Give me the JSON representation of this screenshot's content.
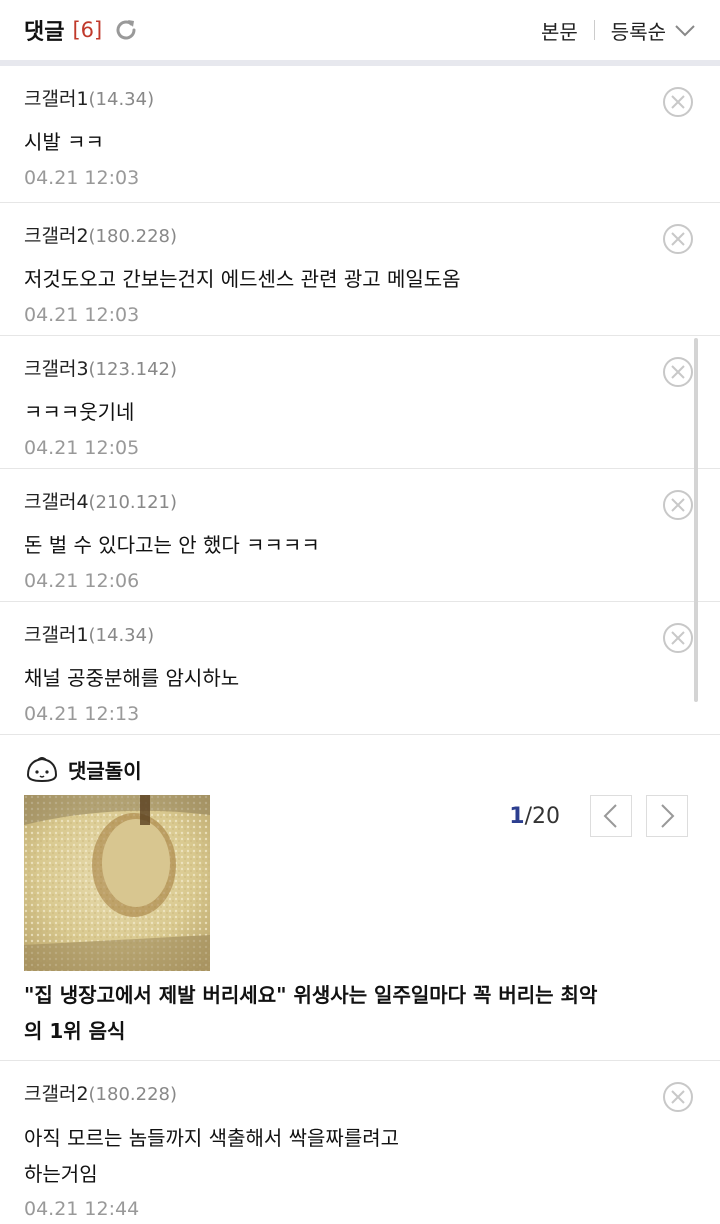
{
  "header": {
    "title": "댓글",
    "count": "[6]",
    "body_label": "본문",
    "sort_label": "등록순"
  },
  "comments": [
    {
      "author": "크갤러1",
      "ip": "(14.34)",
      "body": "시발 ㅋㅋ",
      "time": "04.21 12:03"
    },
    {
      "author": "크갤러2",
      "ip": "(180.228)",
      "body": "저것도오고 간보는건지 에드센스 관련 광고 메일도옴",
      "time": "04.21 12:03"
    },
    {
      "author": "크갤러3",
      "ip": "(123.142)",
      "body": "ㅋㅋㅋ웃기네",
      "time": "04.21 12:05"
    },
    {
      "author": "크갤러4",
      "ip": "(210.121)",
      "body": "돈 벌 수 있다고는 안 했다 ㅋㅋㅋㅋ",
      "time": "04.21 12:06"
    },
    {
      "author": "크갤러1",
      "ip": "(14.34)",
      "body": "채널 공중분해를 암시하노",
      "time": "04.21 12:13"
    },
    {
      "author": "크갤러2",
      "ip": "(180.228)",
      "body_line1": "아직 모르는 놈들까지 색출해서 싹을짜를려고",
      "body_line2": "하는거임",
      "time": "04.21 12:44"
    }
  ],
  "bot": {
    "title": "댓글돌이",
    "page_current": "1",
    "page_total": "/20",
    "headline_line1": "\"집 냉장고에서 제발 버리세요\" 위생사는 일주일마다 꼭 버리는 최악",
    "headline_line2": "의 1위 음식"
  },
  "colors": {
    "accent_red": "#c0392b",
    "page_blue": "#2c3e8f",
    "muted": "#999999"
  }
}
